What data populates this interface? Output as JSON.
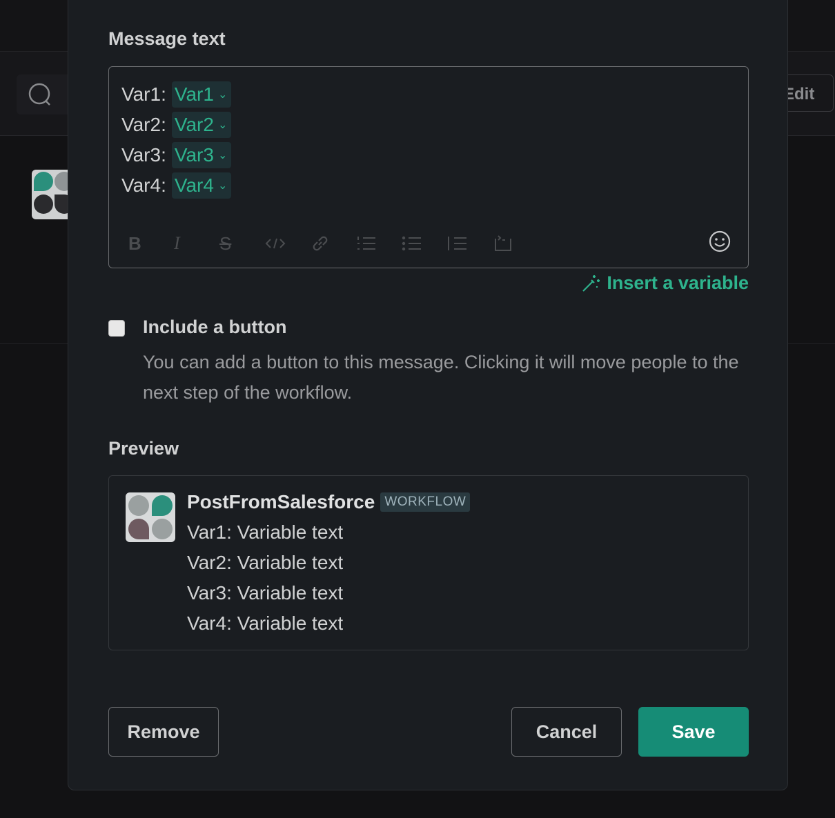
{
  "background": {
    "edit_label": "Edit"
  },
  "modal": {
    "message_text_label": "Message text",
    "editor": {
      "lines": [
        {
          "prefix": "Var1:",
          "chip": "Var1"
        },
        {
          "prefix": "Var2:",
          "chip": "Var2"
        },
        {
          "prefix": "Var3:",
          "chip": "Var3"
        },
        {
          "prefix": "Var4:",
          "chip": "Var4"
        }
      ],
      "toolbar_icons": [
        "bold-icon",
        "italic-icon",
        "strikethrough-icon",
        "code-icon",
        "link-icon",
        "ordered-list-icon",
        "bulleted-list-icon",
        "blockquote-icon",
        "code-block-icon"
      ],
      "toolbar_glyphs": {
        "bold": "B",
        "italic": "I",
        "strike": "S"
      }
    },
    "insert_variable_label": "Insert a variable",
    "include_button": {
      "label": "Include a button",
      "description": "You can add a button to this message. Clicking it will move people to the next step of the workflow.",
      "checked": false
    },
    "preview_label": "Preview",
    "preview": {
      "app_name": "PostFromSalesforce",
      "badge": "WORKFLOW",
      "lines": [
        "Var1: Variable text",
        "Var2: Variable text",
        "Var3: Variable text",
        "Var4: Variable text"
      ]
    },
    "buttons": {
      "remove": "Remove",
      "cancel": "Cancel",
      "save": "Save"
    }
  },
  "colors": {
    "accent": "#2eb38d",
    "save_bg": "#168c76",
    "modal_bg": "#1a1d21"
  }
}
